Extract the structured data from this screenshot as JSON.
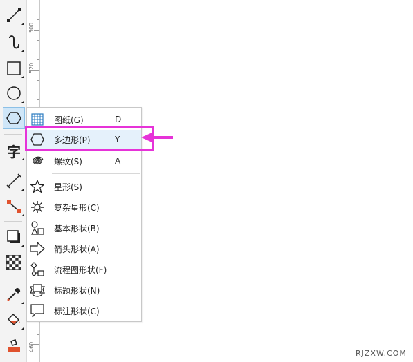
{
  "toolbox": {
    "text_tool_glyph": "字"
  },
  "ruler": {
    "labels": [
      "500",
      "520",
      "480",
      "460"
    ]
  },
  "menu": {
    "items": [
      {
        "label": "图纸(G)",
        "shortcut": "D",
        "icon": "graph-paper-icon"
      },
      {
        "label": "多边形(P)",
        "shortcut": "Y",
        "icon": "polygon-icon"
      },
      {
        "label": "螺纹(S)",
        "shortcut": "A",
        "icon": "spiral-icon"
      },
      {
        "label": "星形(S)",
        "shortcut": "",
        "icon": "star-icon"
      },
      {
        "label": "复杂星形(C)",
        "shortcut": "",
        "icon": "complex-star-icon"
      },
      {
        "label": "基本形状(B)",
        "shortcut": "",
        "icon": "basic-shapes-icon"
      },
      {
        "label": "箭头形状(A)",
        "shortcut": "",
        "icon": "arrow-shapes-icon"
      },
      {
        "label": "流程图形状(F)",
        "shortcut": "",
        "icon": "flowchart-shapes-icon"
      },
      {
        "label": "标题形状(N)",
        "shortcut": "",
        "icon": "banner-shapes-icon"
      },
      {
        "label": "标注形状(C)",
        "shortcut": "",
        "icon": "callout-shapes-icon"
      }
    ]
  },
  "colors": {
    "highlight_box": "#e633d8",
    "menu_highlight": "#e5f1fb",
    "grid_icon_blue": "#2b7bc0"
  },
  "watermark": "RJZXW.COM"
}
